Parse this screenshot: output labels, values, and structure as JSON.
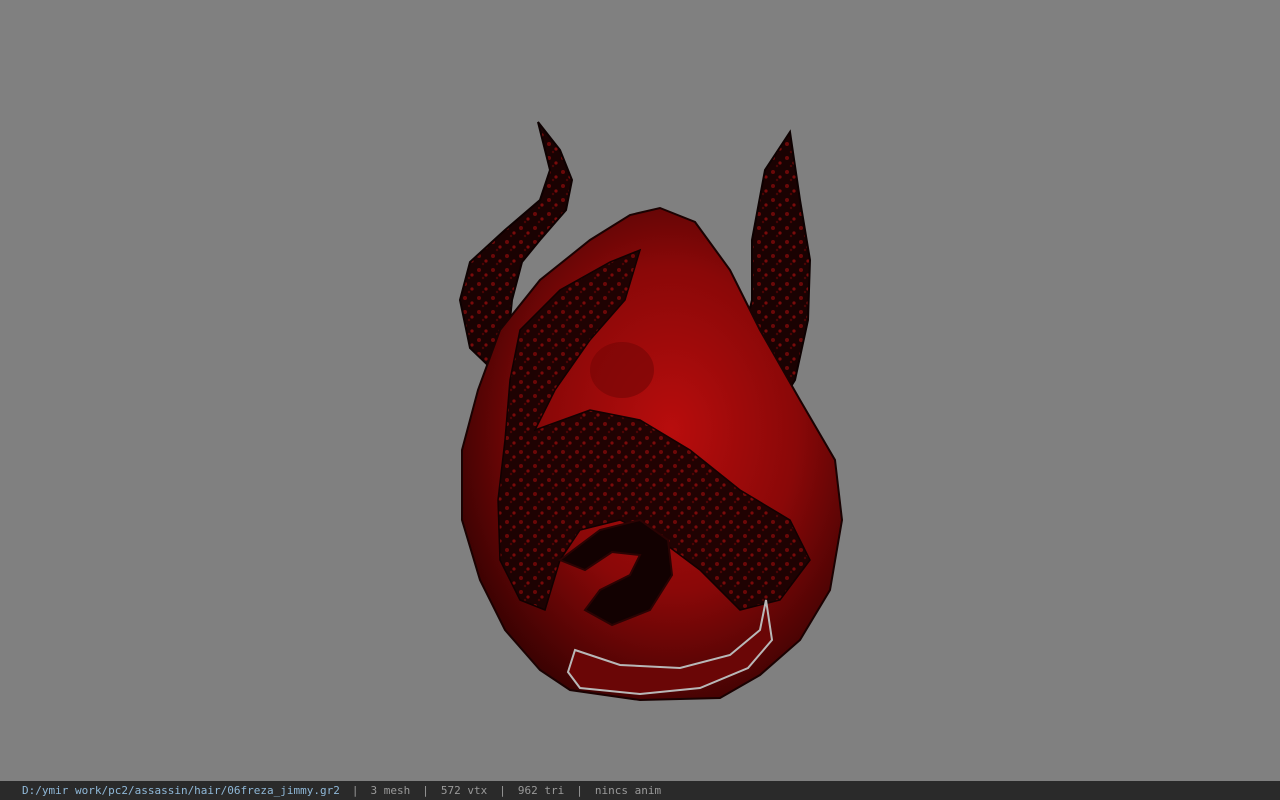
{
  "viewport": {
    "background_color": "#808080",
    "model_primary_color": "#8a0a0a",
    "model_dark_color": "#1a0202"
  },
  "status_bar": {
    "file_path": "D:/ymir work/pc2/assassin/hair/06freza_jimmy.gr2",
    "separator": "|",
    "mesh_count": "3 mesh",
    "vertex_count": "572 vtx",
    "triangle_count": "962 tri",
    "animation": "nincs anim"
  }
}
